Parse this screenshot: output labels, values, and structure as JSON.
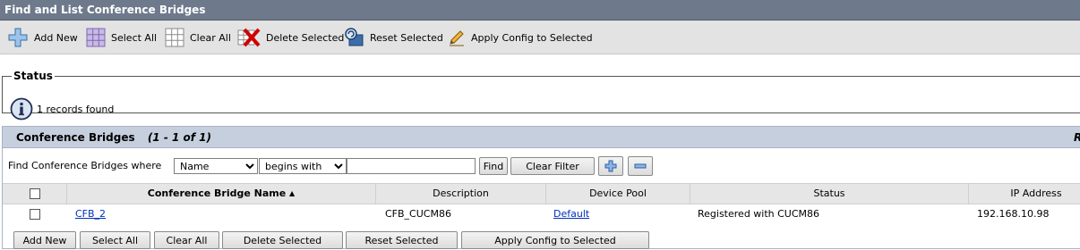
{
  "page_title": "Find and List Conference Bridges",
  "toolbar": {
    "add_new": "Add New",
    "select_all": "Select All",
    "clear_all": "Clear All",
    "delete_selected": "Delete Selected",
    "reset_selected": "Reset Selected",
    "apply_config": "Apply Config to Selected"
  },
  "status": {
    "legend": "Status",
    "message": "1 records found"
  },
  "panel": {
    "title": "Conference Bridges",
    "range": "(1 - 1 of 1)",
    "right_edge": "R"
  },
  "filter": {
    "label": "Find Conference Bridges where",
    "field_value": "Name",
    "operator_value": "begins with",
    "search_value": "",
    "find_label": "Find",
    "clear_filter_label": "Clear Filter"
  },
  "table": {
    "columns": [
      "Conference Bridge Name",
      "Description",
      "Device Pool",
      "Status",
      "IP Address"
    ],
    "sort_indicator": "▲",
    "rows": [
      {
        "name": "CFB_2",
        "description": "CFB_CUCM86",
        "device_pool": "Default",
        "status": "Registered with CUCM86",
        "ip_address": "192.168.10.98"
      }
    ]
  },
  "bottom_buttons": {
    "add_new": "Add New",
    "select_all": "Select All",
    "clear_all": "Clear All",
    "delete_selected": "Delete Selected",
    "reset_selected": "Reset Selected",
    "apply_config": "Apply Config to Selected"
  },
  "icons": {
    "add_new": "plus-icon",
    "select_all": "grid-filled-icon",
    "clear_all": "grid-empty-icon",
    "delete_selected": "delete-x-icon",
    "reset_selected": "reset-icon",
    "apply_config": "pencil-icon",
    "status": "info-icon"
  }
}
